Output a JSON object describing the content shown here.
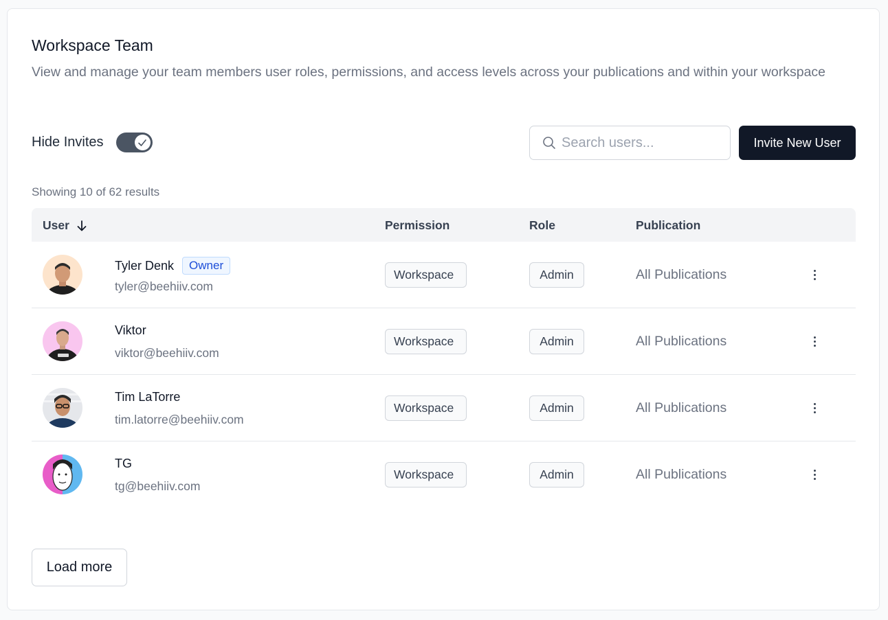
{
  "header": {
    "title": "Workspace Team",
    "description": "View and manage your team members user roles, permissions, and access levels across your publications and within your workspace"
  },
  "controls": {
    "hide_invites_label": "Hide Invites",
    "hide_invites_on": true,
    "search_placeholder": "Search users...",
    "invite_button": "Invite New User"
  },
  "results_text": "Showing 10 of 62 results",
  "table": {
    "columns": {
      "user": "User",
      "permission": "Permission",
      "role": "Role",
      "publication": "Publication"
    },
    "rows": [
      {
        "name": "Tyler Denk",
        "badge": "Owner",
        "email": "tyler@beehiiv.com",
        "permission": "Workspace",
        "role": "Admin",
        "publication": "All Publications",
        "avatar_bg": "#fde4cc"
      },
      {
        "name": "Viktor",
        "badge": "",
        "email": "viktor@beehiiv.com",
        "permission": "Workspace",
        "role": "Admin",
        "publication": "All Publications",
        "avatar_bg": "#f9c6ef"
      },
      {
        "name": "Tim LaTorre",
        "badge": "",
        "email": "tim.latorre@beehiiv.com",
        "permission": "Workspace",
        "role": "Admin",
        "publication": "All Publications",
        "avatar_bg": "#e5e7eb"
      },
      {
        "name": "TG",
        "badge": "",
        "email": "tg@beehiiv.com",
        "permission": "Workspace",
        "role": "Admin",
        "publication": "All Publications",
        "avatar_bg": "#60b8f0"
      }
    ]
  },
  "load_more": "Load more",
  "colors": {
    "primary_button": "#111827",
    "badge_blue": "#1d4ed8",
    "muted_text": "#6b7280"
  }
}
